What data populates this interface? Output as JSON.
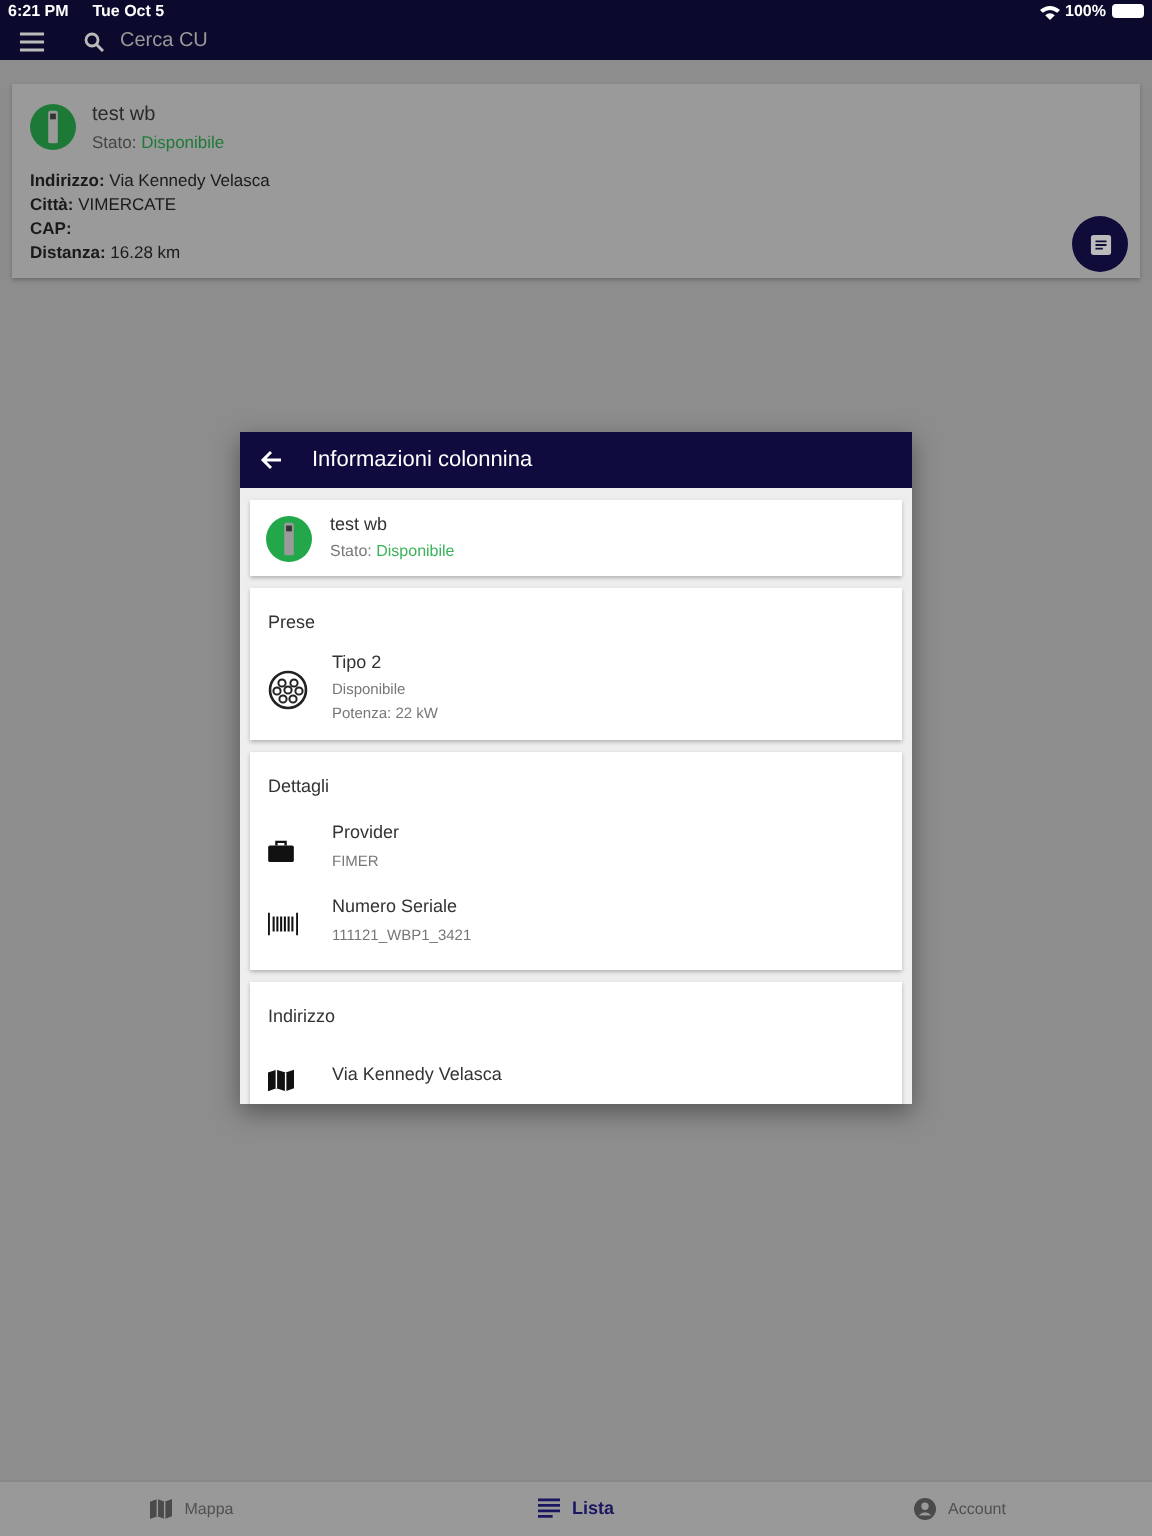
{
  "status_bar": {
    "time": "6:21 PM",
    "date": "Tue Oct 5",
    "battery": "100%"
  },
  "app_bar": {
    "search_placeholder": "Cerca CU"
  },
  "list": [
    {
      "name": "test wb",
      "status_label": "Stato:",
      "status": "Disponibile",
      "fields": [
        {
          "label": "Indirizzo:",
          "value": "Via Kennedy Velasca"
        },
        {
          "label": "Città:",
          "value": "VIMERCATE"
        },
        {
          "label": "CAP:"
        },
        {
          "label": "Distanza:",
          "value": "16.28 km"
        }
      ]
    }
  ],
  "dialog": {
    "title": "Informazioni colonnina",
    "station": {
      "name": "test wb",
      "status_label": "Stato:",
      "status": "Disponibile"
    },
    "sections": [
      {
        "title": "Prese",
        "items": [
          {
            "kind": "plug",
            "title": "Tipo 2",
            "lines": [
              "Disponibile",
              "Potenza: 22 kW"
            ]
          }
        ]
      },
      {
        "title": "Dettagli",
        "items": [
          {
            "kind": "briefcase",
            "title": "Provider",
            "lines": [
              "FIMER"
            ]
          },
          {
            "kind": "barcode",
            "title": "Numero Seriale",
            "lines": [
              "111121_WBP1_3421"
            ]
          }
        ]
      },
      {
        "title": "Indirizzo",
        "items": [
          {
            "kind": "map",
            "title": "Via Kennedy Velasca"
          }
        ]
      }
    ]
  },
  "bottom_nav": [
    {
      "kind": "map",
      "label": "Mappa",
      "selected": false
    },
    {
      "kind": "list",
      "label": "Lista",
      "selected": true
    },
    {
      "kind": "account",
      "label": "Account",
      "selected": false
    }
  ]
}
